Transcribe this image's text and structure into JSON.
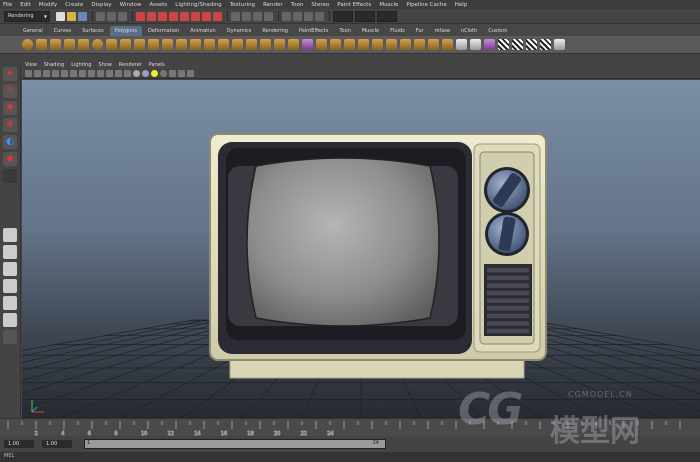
{
  "menubar": [
    "File",
    "Edit",
    "Modify",
    "Create",
    "Display",
    "Window",
    "Assets",
    "Lighting/Shading",
    "Texturing",
    "Render",
    "Toon",
    "Stereo",
    "Paint Effects",
    "Muscle",
    "Pipeline Cache",
    "Help"
  ],
  "status_line": {
    "mode_dropdown": "Rendering"
  },
  "shelf_tabs": [
    "General",
    "Curves",
    "Surfaces",
    "Polygons",
    "Deformation",
    "Animation",
    "Dynamics",
    "Rendering",
    "PaintEffects",
    "Toon",
    "Muscle",
    "Fluids",
    "Fur",
    "mfase",
    "nCloth",
    "Custom"
  ],
  "active_shelf_tab": "Polygons",
  "panel_menu": [
    "View",
    "Shading",
    "Lighting",
    "Show",
    "Renderer",
    "Panels"
  ],
  "time_range": {
    "start": "1.00",
    "playback_start": "1.00",
    "slider_start": "1",
    "slider_end": "24"
  },
  "timeline_ticks": [
    "2",
    "4",
    "6",
    "8",
    "10",
    "12",
    "14",
    "16",
    "18",
    "20",
    "22",
    "24"
  ],
  "watermark": {
    "logo": "CG",
    "cn": "模型网",
    "domain": "CGMODEL.CN"
  },
  "colors": {
    "viewport_top": "#7a8ea6",
    "viewport_bottom": "#262a31",
    "tv_body": "#e2dfbf",
    "tv_bezel": "#2c2a32",
    "screen": "#9a9a9a"
  }
}
